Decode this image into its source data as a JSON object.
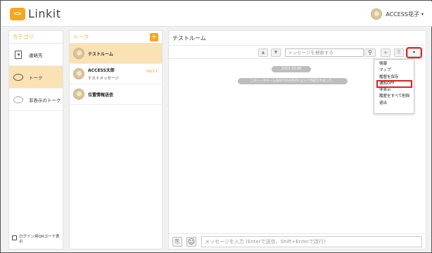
{
  "app": {
    "logo_mark": "<>",
    "name": "Linkit"
  },
  "user": {
    "name": "ACCESS花子",
    "caret": "▾"
  },
  "categories": {
    "header": "カテゴリ",
    "items": [
      {
        "label": "連絡先",
        "icon": "contacts-icon"
      },
      {
        "label": "トーク",
        "icon": "chat-bubble-icon"
      },
      {
        "label": "非表示のトーク",
        "icon": "hidden-chat-icon"
      }
    ],
    "footer": "ログイン用QRコード表示"
  },
  "talks": {
    "header": "トーク",
    "add": "+",
    "items": [
      {
        "name": "テストルーム",
        "sub": "",
        "date": ""
      },
      {
        "name": "ACCESS太郎",
        "sub": "テストメッセージ",
        "date": "09/11"
      },
      {
        "name": "位置情報送信",
        "sub": "",
        "date": ""
      }
    ]
  },
  "room": {
    "title": "テストルーム",
    "toolbar": {
      "up": "▲",
      "down": "▼",
      "search_placeholder": "メッセージを検索する",
      "search": "⚲",
      "add": "+",
      "attach": "⎘",
      "menu": "▾"
    },
    "date": "2023.10.06",
    "system_message": "このトークルームはACCESS花子によって作成されました。",
    "menu_items": [
      "情報",
      "マップ",
      "履歴を保存",
      "通知OFF",
      "非表示",
      "履歴をすべて削除",
      "退出"
    ],
    "composer": {
      "attach": "⎘",
      "emoji": "☺",
      "placeholder": "メッセージを入力 (Enterで送信、Shift+Enterで改行)"
    }
  },
  "colors": {
    "accent": "#f5a623",
    "selected_bg": "#fbe2b4",
    "highlight": "#e02020"
  }
}
